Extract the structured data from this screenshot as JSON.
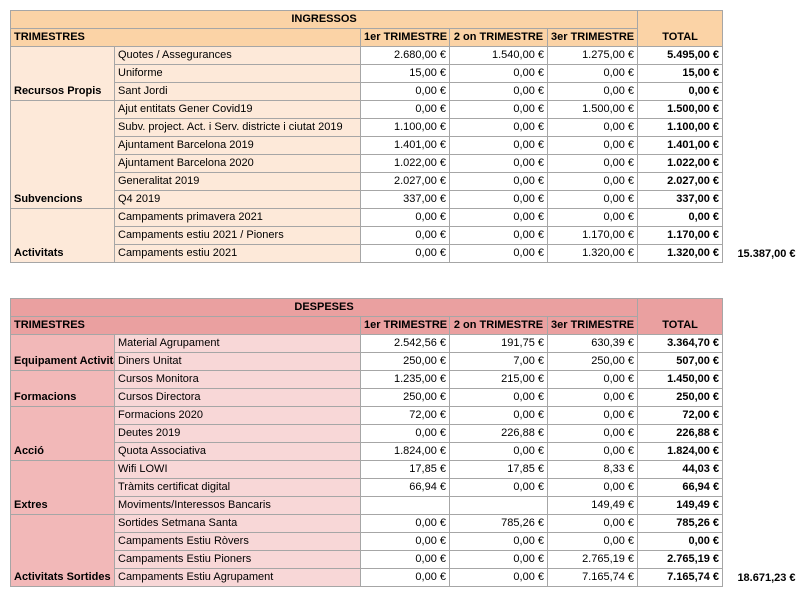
{
  "income": {
    "title": "INGRESSOS",
    "header_label": "TRIMESTRES",
    "col_q1": "1er TRIMESTRE",
    "col_q2": "2 on TRIMESTRE",
    "col_q3": "3er TRIMESTRE",
    "col_total": "TOTAL",
    "grand_total": "15.387,00 €",
    "groups": [
      {
        "name": "Recursos Propis",
        "rows": [
          {
            "concept": "Quotes / Assegurances",
            "q1": "2.680,00 €",
            "q2": "1.540,00 €",
            "q3": "1.275,00 €",
            "total": "5.495,00 €"
          },
          {
            "concept": "Uniforme",
            "q1": "15,00 €",
            "q2": "0,00 €",
            "q3": "0,00 €",
            "total": "15,00 €"
          },
          {
            "concept": "Sant Jordi",
            "q1": "0,00 €",
            "q2": "0,00 €",
            "q3": "0,00 €",
            "total": "0,00 €"
          }
        ]
      },
      {
        "name": "Subvencions",
        "rows": [
          {
            "concept": "Ajut entitats Gener Covid19",
            "q1": "0,00 €",
            "q2": "0,00 €",
            "q3": "1.500,00 €",
            "total": "1.500,00 €"
          },
          {
            "concept": "Subv. project. Act. i Serv. districte i ciutat 2019",
            "q1": "1.100,00 €",
            "q2": "0,00 €",
            "q3": "0,00 €",
            "total": "1.100,00 €"
          },
          {
            "concept": "Ajuntament Barcelona 2019",
            "q1": "1.401,00 €",
            "q2": "0,00 €",
            "q3": "0,00 €",
            "total": "1.401,00 €"
          },
          {
            "concept": "Ajuntament Barcelona 2020",
            "q1": "1.022,00 €",
            "q2": "0,00 €",
            "q3": "0,00 €",
            "total": "1.022,00 €"
          },
          {
            "concept": "Generalitat 2019",
            "q1": "2.027,00 €",
            "q2": "0,00 €",
            "q3": "0,00 €",
            "total": "2.027,00 €"
          },
          {
            "concept": "Q4 2019",
            "q1": "337,00 €",
            "q2": "0,00 €",
            "q3": "0,00 €",
            "total": "337,00 €"
          }
        ]
      },
      {
        "name": "Activitats",
        "rows": [
          {
            "concept": "Campaments primavera 2021",
            "q1": "0,00 €",
            "q2": "0,00 €",
            "q3": "0,00 €",
            "total": "0,00 €"
          },
          {
            "concept": "Campaments estiu 2021 / Pioners",
            "q1": "0,00 €",
            "q2": "0,00 €",
            "q3": "1.170,00 €",
            "total": "1.170,00 €"
          },
          {
            "concept": "Campaments estiu 2021",
            "q1": "0,00 €",
            "q2": "0,00 €",
            "q3": "1.320,00 €",
            "total": "1.320,00 €"
          }
        ]
      }
    ]
  },
  "expenses": {
    "title": "DESPESES",
    "header_label": "TRIMESTRES",
    "col_q1": "1er TRIMESTRE",
    "col_q2": "2 on TRIMESTRE",
    "col_q3": "3er TRIMESTRE",
    "col_total": "TOTAL",
    "grand_total": "18.671,23 €",
    "groups": [
      {
        "name": "Equipament Activitats Cau",
        "rows": [
          {
            "concept": "Material Agrupament",
            "q1": "2.542,56 €",
            "q2": "191,75 €",
            "q3": "630,39 €",
            "total": "3.364,70 €"
          },
          {
            "concept": "Diners Unitat",
            "q1": "250,00 €",
            "q2": "7,00 €",
            "q3": "250,00 €",
            "total": "507,00 €"
          }
        ]
      },
      {
        "name": "Formacions",
        "rows": [
          {
            "concept": "Cursos Monitora",
            "q1": "1.235,00 €",
            "q2": "215,00 €",
            "q3": "0,00 €",
            "total": "1.450,00 €"
          },
          {
            "concept": "Cursos Directora",
            "q1": "250,00 €",
            "q2": "0,00 €",
            "q3": "0,00 €",
            "total": "250,00 €"
          }
        ]
      },
      {
        "name": "Acció",
        "rows": [
          {
            "concept": "Formacions 2020",
            "q1": "72,00 €",
            "q2": "0,00 €",
            "q3": "0,00 €",
            "total": "72,00 €"
          },
          {
            "concept": "Deutes 2019",
            "q1": "0,00 €",
            "q2": "226,88 €",
            "q3": "0,00 €",
            "total": "226,88 €"
          },
          {
            "concept": "Quota Associativa",
            "q1": "1.824,00 €",
            "q2": "0,00 €",
            "q3": "0,00 €",
            "total": "1.824,00 €"
          }
        ]
      },
      {
        "name": "Extres",
        "rows": [
          {
            "concept": "Wifi LOWI",
            "q1": "17,85 €",
            "q2": "17,85 €",
            "q3": "8,33 €",
            "total": "44,03 €"
          },
          {
            "concept": "Tràmits certificat digital",
            "q1": "66,94 €",
            "q2": "0,00 €",
            "q3": "0,00 €",
            "total": "66,94 €"
          },
          {
            "concept": "Moviments/Interessos Bancaris",
            "q1": "",
            "q2": "",
            "q3": "149,49 €",
            "total": "149,49 €"
          }
        ]
      },
      {
        "name": "Activitats Sortides",
        "rows": [
          {
            "concept": "Sortides Setmana Santa",
            "q1": "0,00 €",
            "q2": "785,26 €",
            "q3": "0,00 €",
            "total": "785,26 €"
          },
          {
            "concept": "Campaments Estiu Ròvers",
            "q1": "0,00 €",
            "q2": "0,00 €",
            "q3": "0,00 €",
            "total": "0,00 €"
          },
          {
            "concept": "Campaments Estiu Pioners",
            "q1": "0,00 €",
            "q2": "0,00 €",
            "q3": "2.765,19 €",
            "total": "2.765,19 €"
          },
          {
            "concept": "Campaments Estiu Agrupament",
            "q1": "0,00 €",
            "q2": "0,00 €",
            "q3": "7.165,74 €",
            "total": "7.165,74 €"
          }
        ]
      }
    ]
  },
  "colors": {
    "income_header": "#fbd3a6",
    "income_row": "#fde9d9",
    "expense_header": "#eaa0a0",
    "expense_row": "#f8d7d7"
  }
}
